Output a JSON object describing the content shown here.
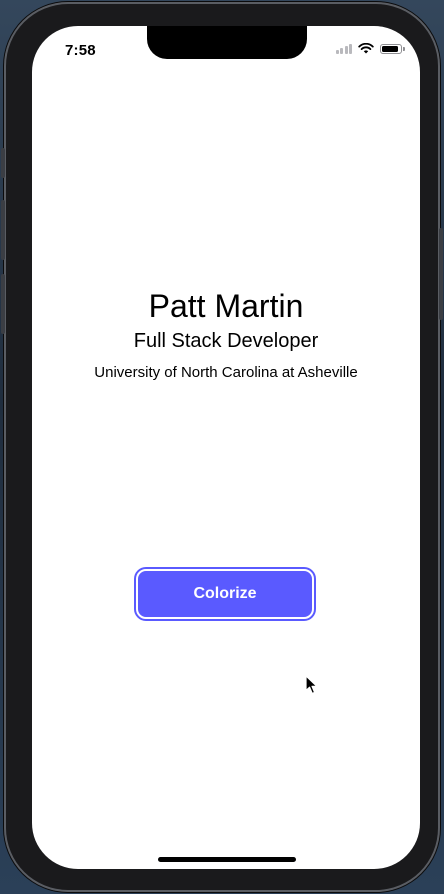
{
  "status_bar": {
    "time": "7:58",
    "battery_level": 0.9
  },
  "profile": {
    "name": "Patt Martin",
    "title": "Full Stack Developer",
    "school": "University of North Carolina at Asheville"
  },
  "actions": {
    "colorize_label": "Colorize"
  },
  "colors": {
    "button_accent": "#5a5aff",
    "screen_background": "#ffffff"
  },
  "icons": {
    "signal": "cellular-signal-icon",
    "wifi": "wifi-icon",
    "battery": "battery-icon",
    "cursor": "mouse-pointer-icon"
  }
}
